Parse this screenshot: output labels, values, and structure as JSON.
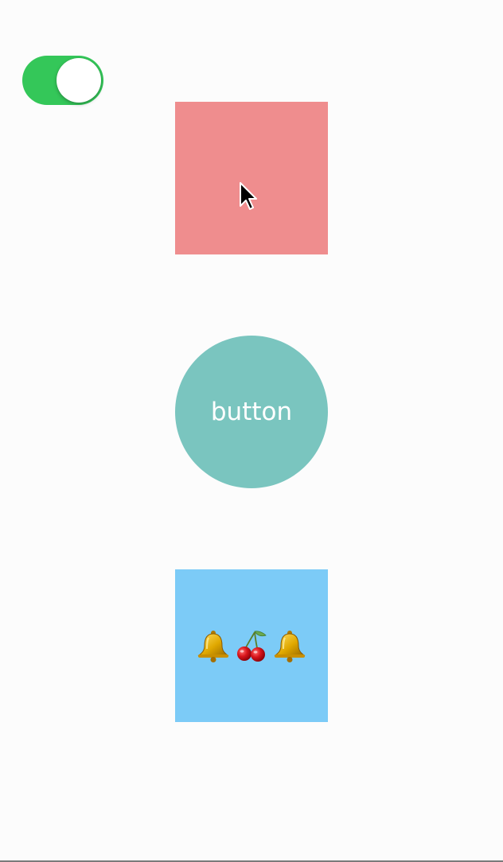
{
  "toggle": {
    "state": "on",
    "color": "#34c759"
  },
  "red_square": {
    "color": "#ef8d8e"
  },
  "circle_button": {
    "label": "button",
    "color": "#7ac5bf"
  },
  "slot_display": {
    "color": "#7ccbf7",
    "symbols": [
      "bell",
      "cherries",
      "bell"
    ]
  }
}
